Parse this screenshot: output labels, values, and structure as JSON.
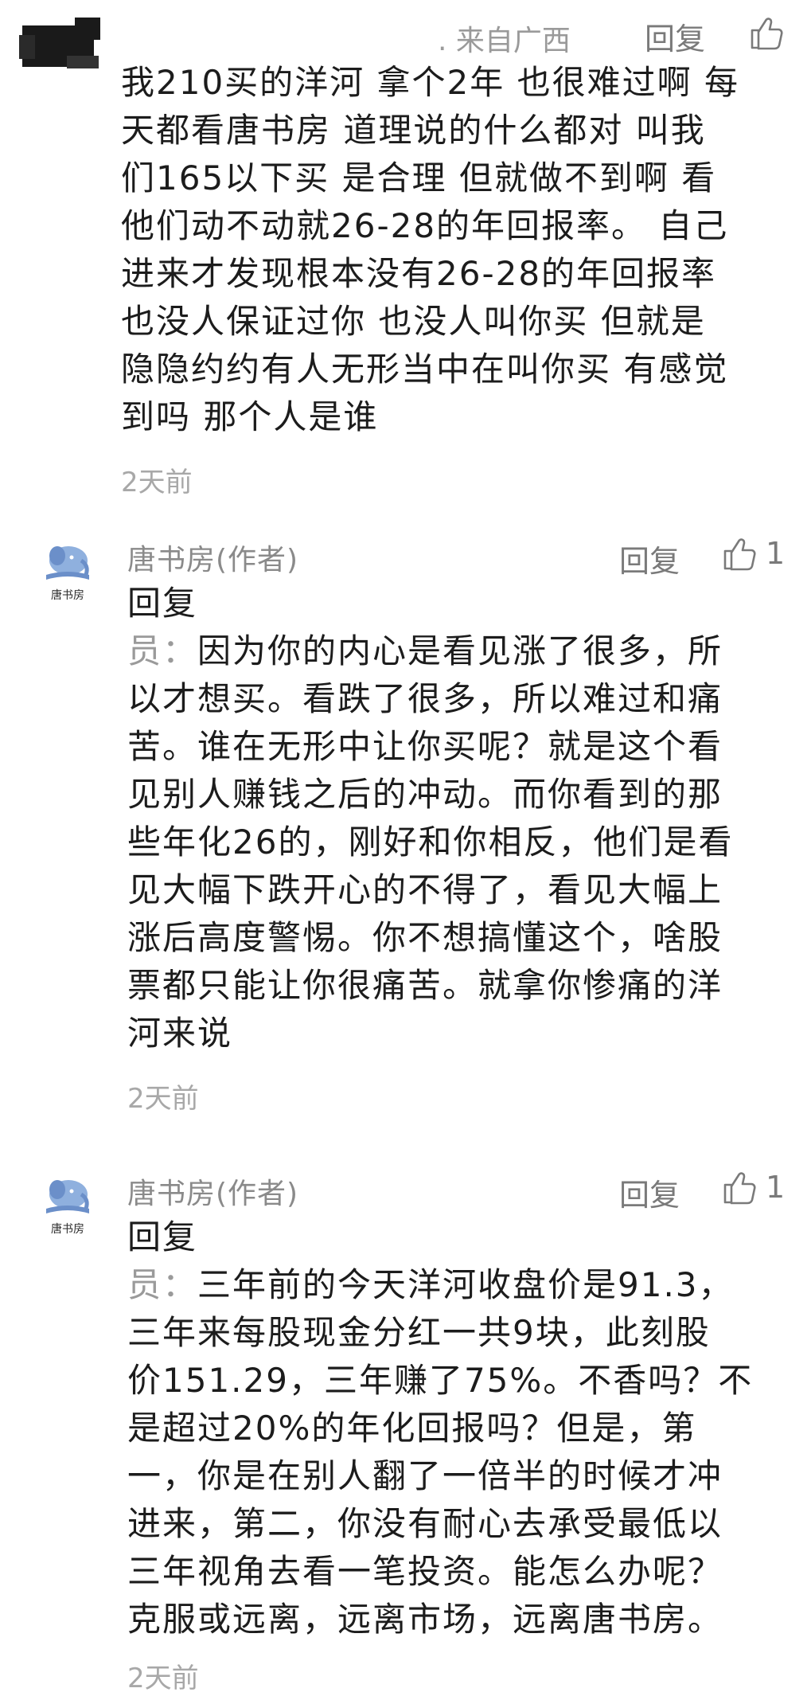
{
  "comments": [
    {
      "from": ". 来自广西",
      "reply_label": "回复",
      "body_lines": [
        "我210买的洋河 拿个2年  也很难过啊 每",
        "天都看唐书房 道理说的什么都对  叫我",
        "们165以下买  是合理  但就做不到啊 看",
        "他们动不动就26-28的年回报率。 自己",
        "进来才发现根本没有26-28的年回报率",
        "也没人保证过你 也没人叫你买  但就是",
        "隐隐约约有人无形当中在叫你买  有感觉",
        "到吗  那个人是谁"
      ],
      "time": "2天前"
    },
    {
      "author": "唐书房(作者)",
      "avatar_text": "唐书房",
      "reply_label": "回复",
      "likes": "1",
      "reply_prefix": "回复",
      "body_lines": [
        {
          "prefix": "员：",
          "text": "因为你的内心是看见涨了很多，所"
        },
        {
          "prefix": "",
          "text": "以才想买。看跌了很多，所以难过和痛"
        },
        {
          "prefix": "",
          "text": "苦。谁在无形中让你买呢？就是这个看"
        },
        {
          "prefix": "",
          "text": "见别人赚钱之后的冲动。而你看到的那"
        },
        {
          "prefix": "",
          "text": "些年化26的，刚好和你相反，他们是看"
        },
        {
          "prefix": "",
          "text": "见大幅下跌开心的不得了，看见大幅上"
        },
        {
          "prefix": "",
          "text": "涨后高度警惕。你不想搞懂这个，啥股"
        },
        {
          "prefix": "",
          "text": "票都只能让你很痛苦。就拿你惨痛的洋"
        },
        {
          "prefix": "",
          "text": "河来说"
        }
      ],
      "time": "2天前"
    },
    {
      "author": "唐书房(作者)",
      "avatar_text": "唐书房",
      "reply_label": "回复",
      "likes": "1",
      "reply_prefix": "回复",
      "body_lines": [
        {
          "prefix": "员：",
          "text": "三年前的今天洋河收盘价是91.3，"
        },
        {
          "prefix": "",
          "text": "三年来每股现金分红一共9块，此刻股"
        },
        {
          "prefix": "",
          "text": "价151.29，三年赚了75%。不香吗？不"
        },
        {
          "prefix": "",
          "text": "是超过20%的年化回报吗？但是，第"
        },
        {
          "prefix": "",
          "text": "一，你是在别人翻了一倍半的时候才冲"
        },
        {
          "prefix": "",
          "text": "进来，第二，你没有耐心去承受最低以"
        },
        {
          "prefix": "",
          "text": "三年视角去看一笔投资。能怎么办呢？"
        },
        {
          "prefix": "",
          "text": "克服或远离，远离市场，远离唐书房。"
        }
      ],
      "time": "2天前"
    }
  ],
  "icons": {
    "like": "thumbs-up-icon",
    "avatar_logo": "elephant-book-icon"
  },
  "colors": {
    "text": "#1c1c1c",
    "muted": "#8a8a8a",
    "avatar_blue": "#6b8fc9"
  }
}
